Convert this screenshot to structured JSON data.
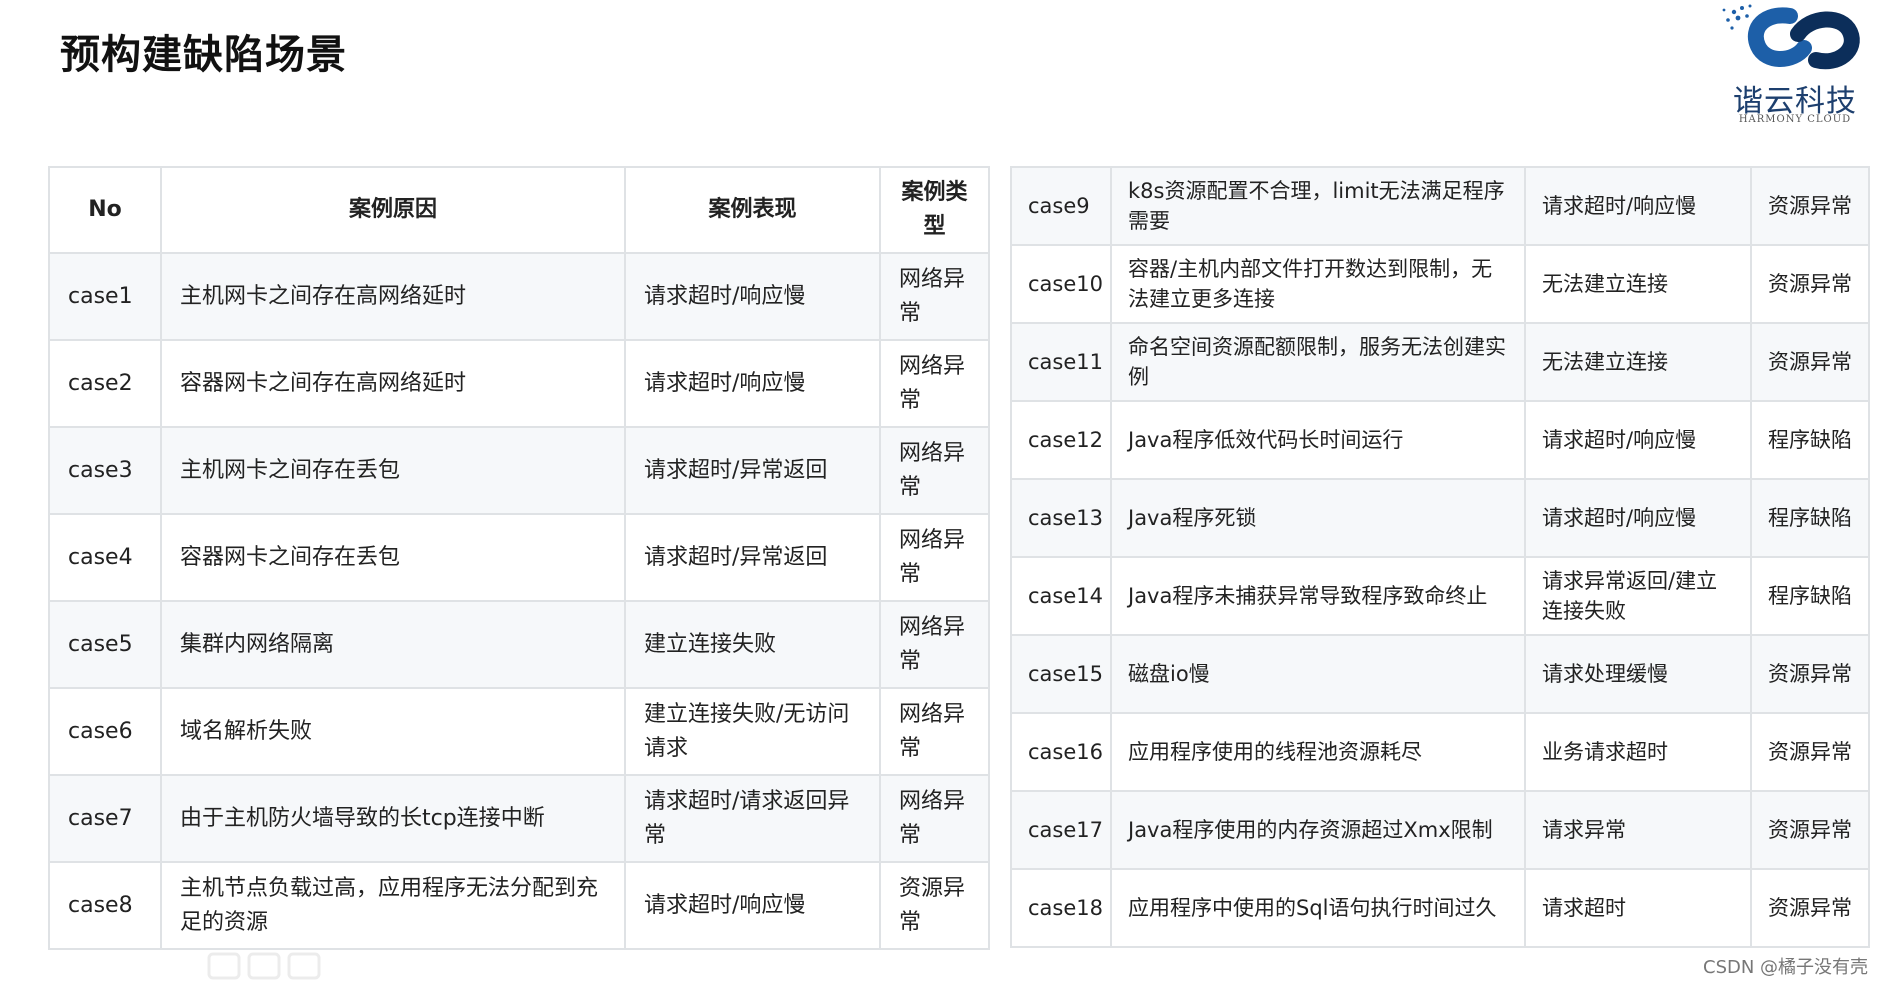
{
  "title": "预构建缺陷场景",
  "logo": {
    "name_cn": "谐云科技",
    "name_en": "HARMONY CLOUD"
  },
  "left_table": {
    "headers": [
      "No",
      "案例原因",
      "案例表现",
      "案例类型"
    ],
    "rows": [
      [
        "case1",
        "主机网卡之间存在高网络延时",
        "请求超时/响应慢",
        "网络异常"
      ],
      [
        "case2",
        "容器网卡之间存在高网络延时",
        "请求超时/响应慢",
        "网络异常"
      ],
      [
        "case3",
        "主机网卡之间存在丢包",
        "请求超时/异常返回",
        "网络异常"
      ],
      [
        "case4",
        "容器网卡之间存在丢包",
        "请求超时/异常返回",
        "网络异常"
      ],
      [
        "case5",
        "集群内网络隔离",
        "建立连接失败",
        "网络异常"
      ],
      [
        "case6",
        "域名解析失败",
        "建立连接失败/无访问请求",
        "网络异常"
      ],
      [
        "case7",
        "由于主机防火墙导致的长tcp连接中断",
        "请求超时/请求返回异常",
        "网络异常"
      ],
      [
        "case8",
        "主机节点负载过高，应用程序无法分配到充足的资源",
        "请求超时/响应慢",
        "资源异常"
      ]
    ]
  },
  "right_table": {
    "rows": [
      [
        "case9",
        "k8s资源配置不合理，limit无法满足程序需要",
        "请求超时/响应慢",
        "资源异常"
      ],
      [
        "case10",
        "容器/主机内部文件打开数达到限制，无法建立更多连接",
        "无法建立连接",
        "资源异常"
      ],
      [
        "case11",
        "命名空间资源配额限制，服务无法创建实例",
        "无法建立连接",
        "资源异常"
      ],
      [
        "case12",
        "Java程序低效代码长时间运行",
        "请求超时/响应慢",
        "程序缺陷"
      ],
      [
        "case13",
        "Java程序死锁",
        "请求超时/响应慢",
        "程序缺陷"
      ],
      [
        "case14",
        "Java程序未捕获异常导致程序致命终止",
        "请求异常返回/建立连接失败",
        "程序缺陷"
      ],
      [
        "case15",
        "磁盘io慢",
        "请求处理缓慢",
        "资源异常"
      ],
      [
        "case16",
        "应用程序使用的线程池资源耗尽",
        "业务请求超时",
        "资源异常"
      ],
      [
        "case17",
        "Java程序使用的内存资源超过Xmx限制",
        "请求异常",
        "资源异常"
      ],
      [
        "case18",
        "应用程序中使用的Sql语句执行时间过久",
        "请求超时",
        "资源异常"
      ]
    ]
  },
  "watermark": "CSDN @橘子没有壳",
  "colors": {
    "border": "#dfe2e5",
    "stripe": "#f6f8fa",
    "logo_blue": "#1d3f6e"
  }
}
